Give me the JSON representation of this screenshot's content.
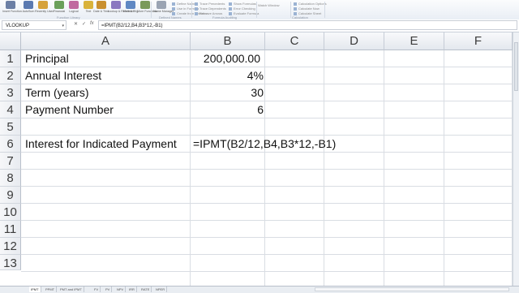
{
  "ribbon": {
    "buttons": [
      {
        "label": "Insert Function",
        "icon": "fx-icon",
        "color": "#6b7fa5"
      },
      {
        "label": "AutoSum",
        "icon": "sigma-icon",
        "color": "#5a79b0"
      },
      {
        "label": "Recently Used",
        "icon": "star-icon",
        "color": "#d6a23a"
      },
      {
        "label": "Financial",
        "icon": "book-icon",
        "color": "#6aa05a"
      },
      {
        "label": "Logical",
        "icon": "question-icon",
        "color": "#c06aa0"
      },
      {
        "label": "Text",
        "icon": "text-icon",
        "color": "#d9b33b"
      },
      {
        "label": "Date & Time",
        "icon": "clock-icon",
        "color": "#c9902f"
      },
      {
        "label": "Lookup & Reference",
        "icon": "lookup-icon",
        "color": "#8a78c0"
      },
      {
        "label": "Math & Trig",
        "icon": "theta-icon",
        "color": "#5f88c3"
      },
      {
        "label": "More Functions",
        "icon": "more-functions-icon",
        "color": "#7a9a5a"
      },
      {
        "label": "Name Manager",
        "icon": "name-manager-icon",
        "color": "#9aa4b3"
      }
    ],
    "define_names": [
      "Define Name",
      "Use in Formula",
      "Create from Selection"
    ],
    "auditing": [
      "Trace Precedents",
      "Trace Dependents",
      "Remove Arrows"
    ],
    "auditing2": [
      "Show Formulas",
      "Error Checking",
      "Evaluate Formula"
    ],
    "watch": "Watch Window",
    "calc": [
      "Calculation Options",
      "Calculate Now",
      "Calculate Sheet"
    ],
    "group_labels": [
      "Function Library",
      "Defined Names",
      "Formula Auditing",
      "Calculation"
    ]
  },
  "formula_bar": {
    "name_box": "VLOOKUP",
    "cancel": "✕",
    "enter": "✓",
    "fx": "fx",
    "content": "=IPMT(B2/12,B4,B3*12,-B1)"
  },
  "columns": [
    "A",
    "B",
    "C",
    "D",
    "E",
    "F"
  ],
  "rows": [
    "1",
    "2",
    "3",
    "4",
    "5",
    "6",
    "7",
    "8",
    "9",
    "10",
    "11",
    "12",
    "13"
  ],
  "cells": {
    "A1": "Principal",
    "B1": "200,000.00",
    "A2": "Annual Interest",
    "B2": "4%",
    "A3": "Term (years)",
    "B3": "30",
    "A4": "Payment Number",
    "B4": "6",
    "A6": "Interest for Indicated Payment",
    "B6": "=IPMT(B2/12,B4,B3*12,-B1)"
  },
  "sheet_tabs": [
    "IPMT",
    "PPMT",
    "PMT and IPMT",
    "FV",
    "PV",
    "NPV",
    "IRR",
    "RATE",
    "NPER"
  ],
  "active_tab": "IPMT"
}
